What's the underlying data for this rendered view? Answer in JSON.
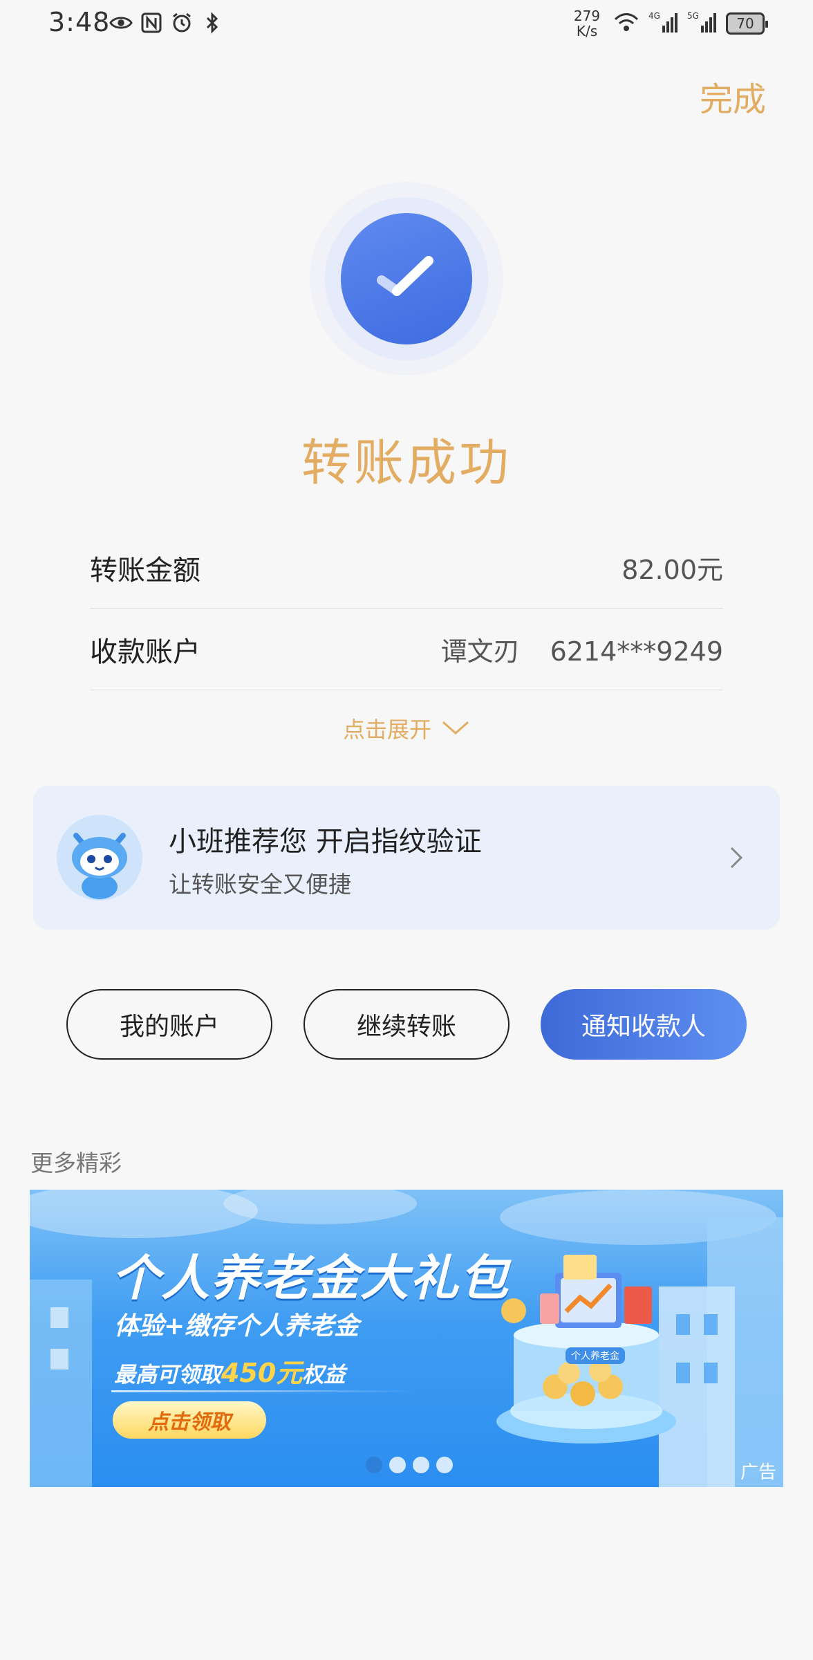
{
  "status_bar": {
    "time": "3:48",
    "net_speed_value": "279",
    "net_speed_unit": "K/s",
    "battery": "70",
    "left_icons": [
      "eye-icon",
      "nfc-icon",
      "alarm-icon",
      "bluetooth-icon"
    ],
    "right_icons": [
      "wifi-icon",
      "signal-4g-icon",
      "signal-5g-icon"
    ]
  },
  "header": {
    "done_label": "完成"
  },
  "result": {
    "title": "转账成功",
    "accent_color": "#e2ad63",
    "success_color": "#4a78e6"
  },
  "details": [
    {
      "label": "转账金额",
      "value": "82.00元"
    },
    {
      "label": "收款账户",
      "name": "谭文刃",
      "account": "6214***9249"
    }
  ],
  "expand_label": "点击展开",
  "recommendation": {
    "title": "小班推荐您 开启指纹验证",
    "subtitle": "让转账安全又便捷"
  },
  "actions": {
    "my_account": "我的账户",
    "continue_transfer": "继续转账",
    "notify_payee": "通知收款人"
  },
  "more_title": "更多精彩",
  "banner": {
    "title": "个人养老金大礼包",
    "line1": "体验+缴存个人养老金",
    "line2_prefix": "最高可领取",
    "line2_amount": "450元",
    "line2_suffix": "权益",
    "cta": "点击领取",
    "jar_label": "个人养老金",
    "ad_label": "广告",
    "slide_count": 4,
    "active_slide": 1
  }
}
